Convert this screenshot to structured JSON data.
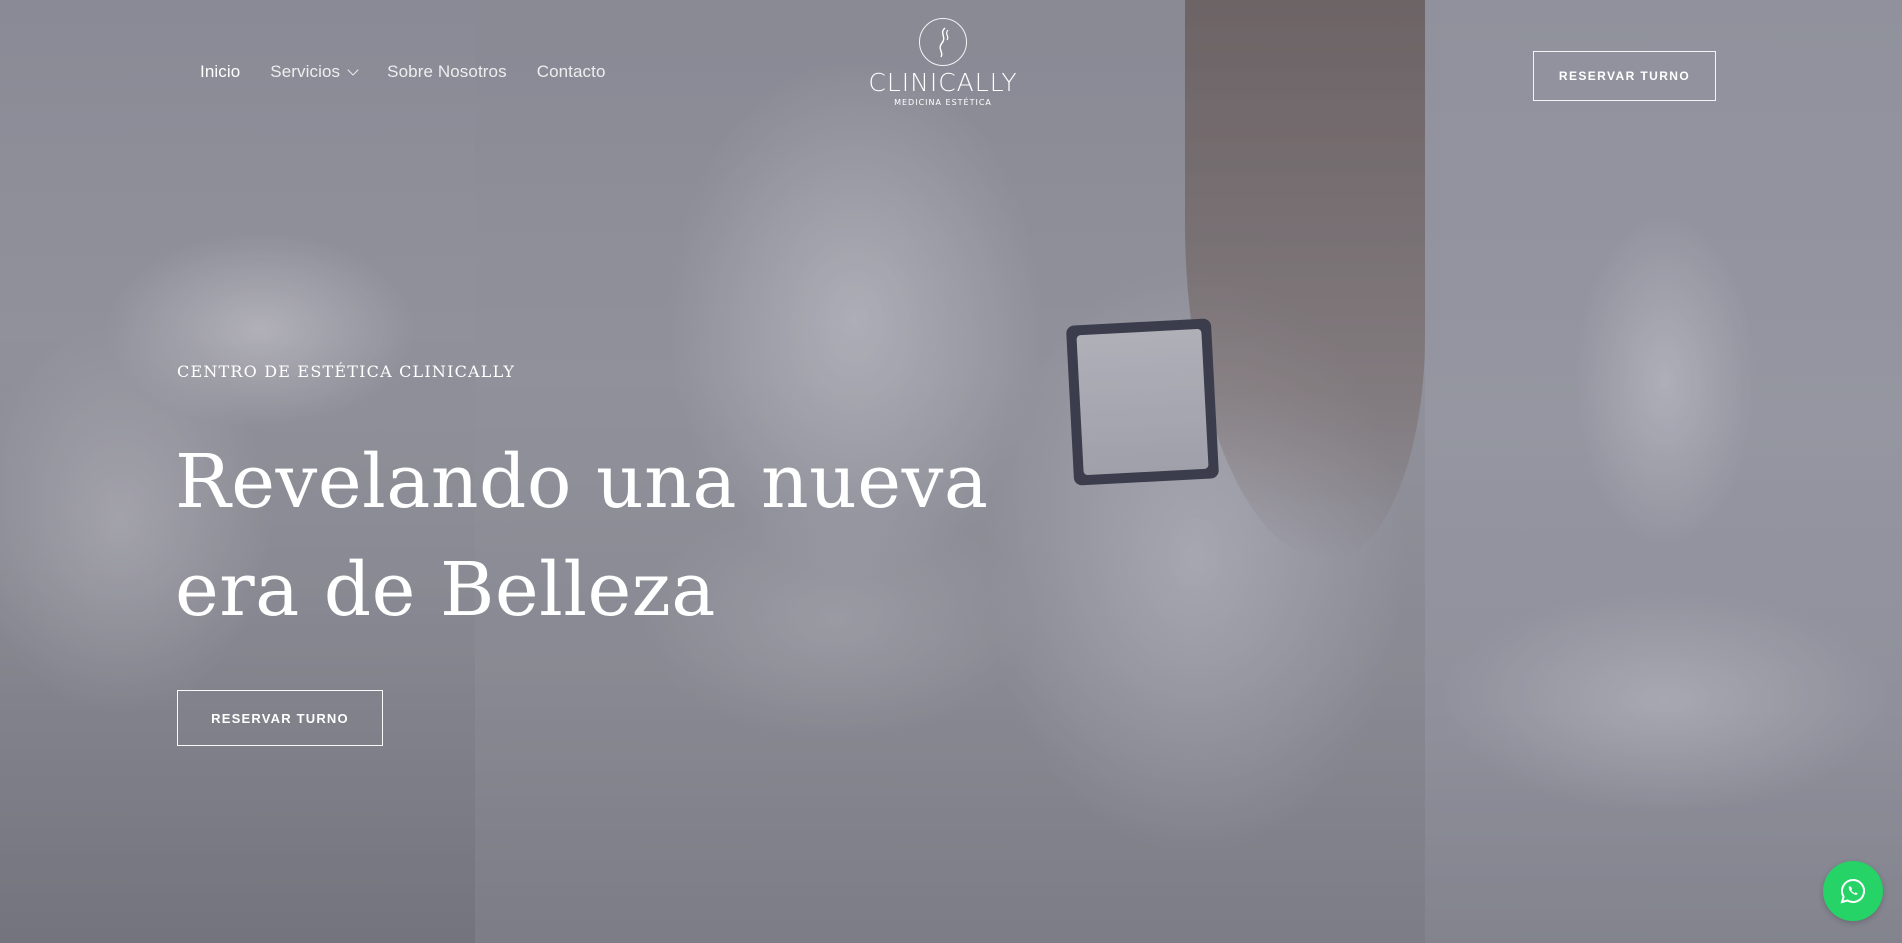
{
  "nav": {
    "items": [
      {
        "label": "Inicio",
        "active": true
      },
      {
        "label": "Servicios",
        "has_dropdown": true
      },
      {
        "label": "Sobre Nosotros"
      },
      {
        "label": "Contacto"
      }
    ]
  },
  "logo": {
    "name": "CLINICALLY",
    "tagline": "MEDICINA ESTÉTICA"
  },
  "header": {
    "cta_label": "RESERVAR TURNO"
  },
  "hero": {
    "eyebrow": "CENTRO DE ESTÉTICA CLINICALLY",
    "headline_line1": "Revelando una nueva",
    "headline_line2": "era de Belleza",
    "cta_label": "RESERVAR TURNO"
  },
  "floating": {
    "whatsapp_icon": "whatsapp-icon"
  },
  "colors": {
    "whatsapp": "#25d366",
    "text": "#ffffff"
  }
}
